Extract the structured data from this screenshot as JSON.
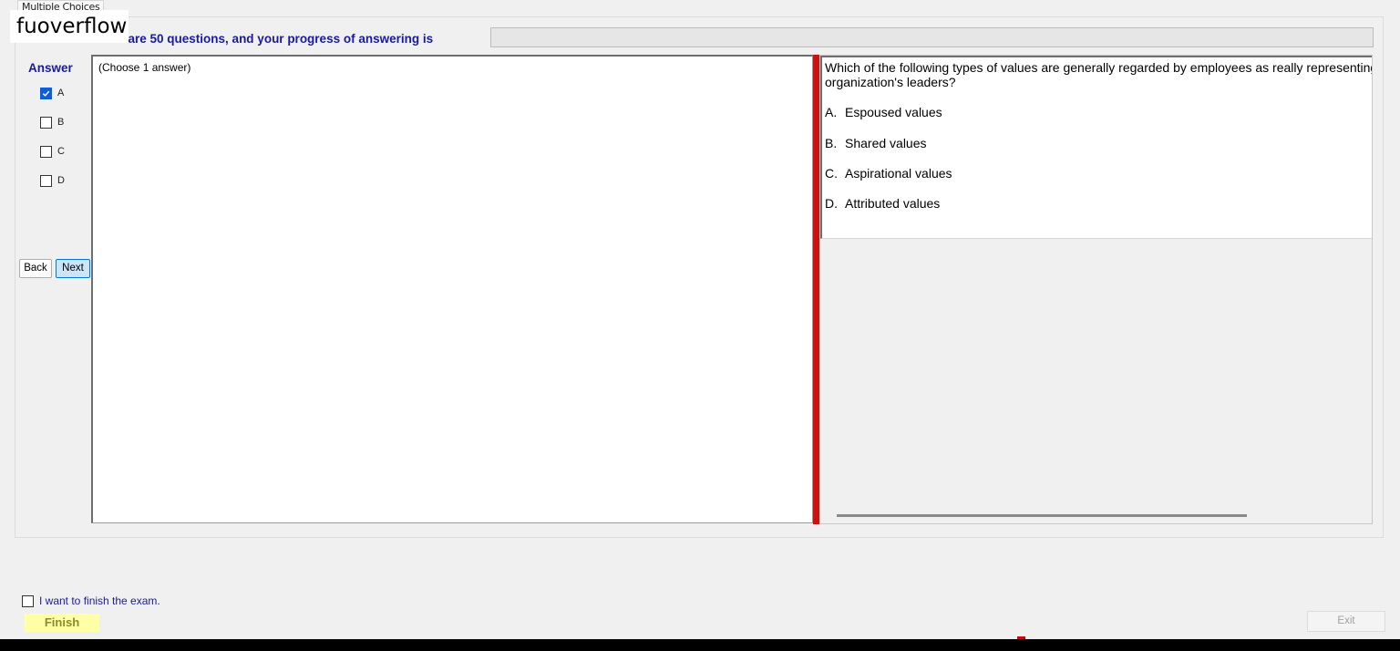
{
  "window": {
    "tab_label": "Multiple Choices",
    "watermark": "fuoverflow"
  },
  "progress": {
    "text": "There are 50 questions, and your progress of answering is",
    "value_percent": 0
  },
  "answer_panel": {
    "title": "Answer",
    "options": [
      {
        "label": "A",
        "checked": true
      },
      {
        "label": "B",
        "checked": false
      },
      {
        "label": "C",
        "checked": false
      },
      {
        "label": "D",
        "checked": false
      }
    ]
  },
  "nav": {
    "back_label": "Back",
    "next_label": "Next"
  },
  "left_pane": {
    "instruction": "(Choose 1 answer)"
  },
  "question": {
    "text": "Which of the following types of values are generally regarded by employees as really representing the organization's leaders?",
    "choices": [
      {
        "letter": "A.",
        "text": "Espoused values"
      },
      {
        "letter": "B.",
        "text": "Shared values"
      },
      {
        "letter": "C.",
        "text": "Aspirational values"
      },
      {
        "letter": "D.",
        "text": "Attributed values"
      }
    ]
  },
  "footer": {
    "finish_check_label": "I want to finish the exam.",
    "finish_checked": false,
    "finish_button": "Finish",
    "exit_button": "Exit"
  },
  "colors": {
    "accent_blue": "#1a1aa0",
    "splitter_red": "#cc1111",
    "finish_yellow": "#ffffa6",
    "checkbox_blue": "#0b5ed7"
  }
}
